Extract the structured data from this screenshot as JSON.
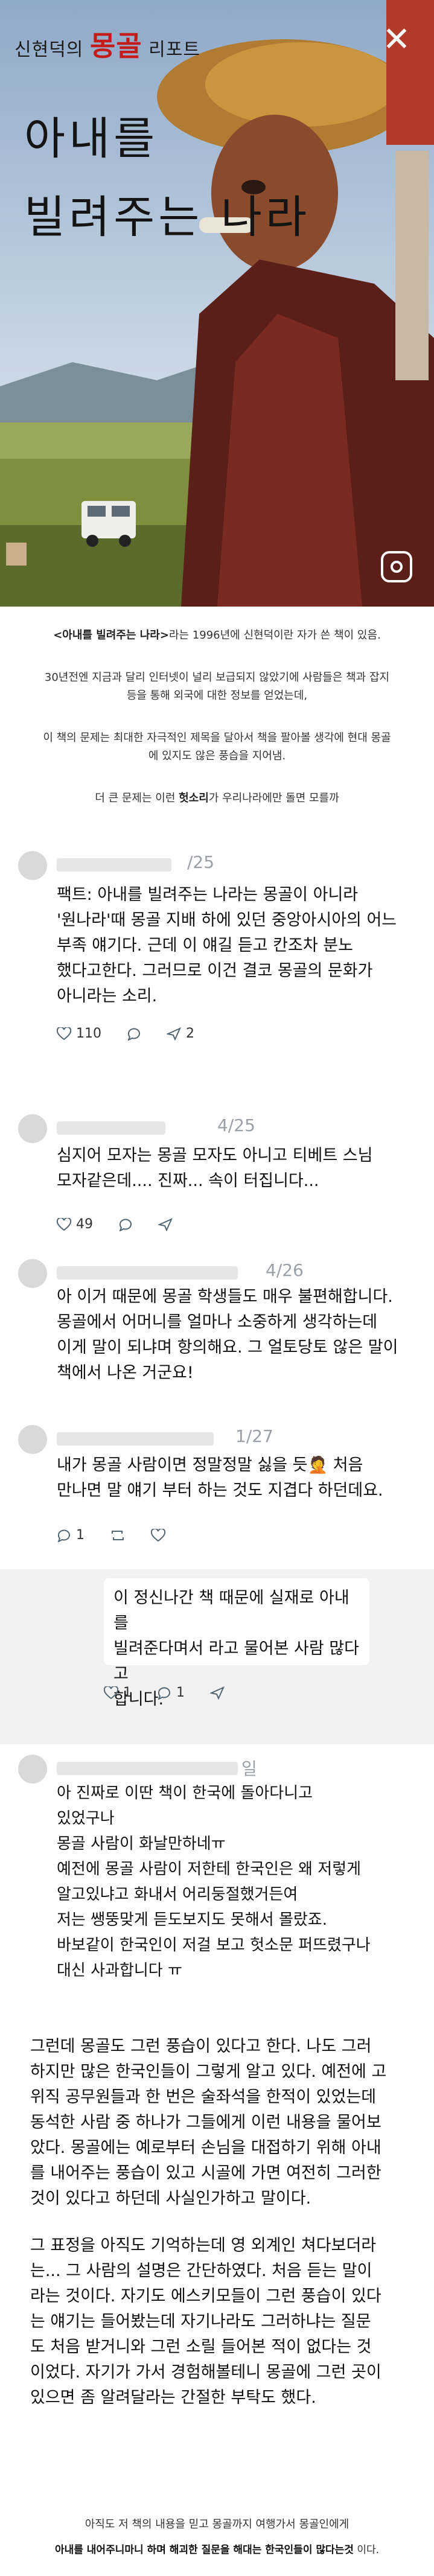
{
  "book": {
    "series_prefix": "신현덕의",
    "series_main": "몽골",
    "series_suffix": "리포트",
    "title_line1": "아내를",
    "title_line2": "빌려주는 나라",
    "close_label": "✕"
  },
  "caption": {
    "line1_title": "<아내를 빌려주는 나라>",
    "line1_rest": "라는 1996년에 신현덕이란 자가 쓴 책이 있음.",
    "line2": "30년전엔 지금과 달리 인터넷이 널리 보급되지 않았기에 사람들은 책과 잡지",
    "line3": "등을 통해 외국에 대한 정보를 얻었는데,",
    "line4": "이 책의 문제는 최대한 자극적인 제목을 달아서 책을 팔아볼 생각에 현대 몽골",
    "line5": "에 있지도 않은 풍습을 지어냄.",
    "line6_pre": "더 큰 문제는 이런 ",
    "line6_bold": "헛소리",
    "line6_post": "가 우리나라에만 돌면 모를까"
  },
  "tweets": [
    {
      "date": "/25",
      "lines": [
        "팩트: 아내를 빌려주는 나라는 몽골이 아니라",
        "'원나라'때 몽골 지배 하에 있던 중앙아시아의 어느",
        "부족 얘기다. 근데 이 얘길 듣고 칸조차 분노",
        "했다고한다. 그러므로 이건 결코 몽골의 문화가",
        "아니라는 소리."
      ],
      "likes": "110",
      "reposts": "2"
    },
    {
      "date": "4/25",
      "lines": [
        "심지어 모자는 몽골 모자도 아니고 티베트 스님",
        "모자같은데.... 진짜... 속이 터집니다..."
      ],
      "likes": "49"
    },
    {
      "date": "4/26",
      "lines": [
        "아 이거 때문에 몽골 학생들도 매우 불편해합니다.",
        "몽골에서 어머니를 얼마나 소중하게 생각하는데",
        "이게 말이 되냐며 항의해요. 그 얼토당토 않은 말이",
        "책에서 나온 거군요!"
      ]
    },
    {
      "date": "1/27",
      "lines": [
        "내가 몽골 사람이면 정말정말 싫을 듯🤦 처음",
        "만나면 말 얘기 부터 하는 것도 지겹다 하던데요."
      ],
      "likes": "1"
    }
  ],
  "dm": {
    "lines": [
      "이 정신나간 책 때문에 실재로 아내를",
      "빌려준다며서 라고 물어본 사람 많다고",
      "합니다."
    ],
    "likes": "1",
    "reposts": "1"
  },
  "message_block": {
    "date": "일",
    "lines": [
      "아 진짜로 이딴 책이 한국에 돌아다니고",
      "있었구나",
      "몽골 사람이 화날만하네ㅠ",
      "예전에 몽골 사람이 저한테 한국인은 왜 저렇게",
      "알고있냐고 화내서 어리둥절했거든여",
      "저는 쌩뚱맞게 듣도보지도 못해서 몰랐죠.",
      "바보같이 한국인이 저걸 보고 헛소문 퍼뜨렸구나",
      "대신 사과합니다 ㅠ"
    ]
  },
  "article": {
    "para1": [
      "그런데 몽골도 그런 풍습이 있다고 한다. 나도 그러",
      "하지만 많은 한국인들이 그렇게 알고 있다. 예전에 고",
      "위직 공무원들과 한 번은 술좌석을 한적이 있었는데",
      "동석한 사람 중 하나가 그들에게 이런 내용을 물어보",
      "았다. 몽골에는 예로부터 손님을 대접하기 위해 아내",
      "를 내어주는 풍습이 있고 시골에 가면 여전히 그러한",
      "것이 있다고 하던데 사실인가하고 말이다."
    ],
    "para2": [
      "그 표정을 아직도 기억하는데 영 외계인 쳐다보더라",
      "는... 그 사람의 설명은 간단하였다. 처음 듣는 말이",
      "라는 것이다. 자기도 에스키모들이 그런 풍습이 있다",
      "는 얘기는 들어봤는데 자기나라도 그러하냐는 질문",
      "도 처음 받거니와 그런 소릴 들어본 적이 없다는 것",
      "이었다. 자기가 가서 경험해볼테니 몽골에 그런 곳이",
      "있으면 좀 알려달라는 간절한 부탁도 했다."
    ]
  },
  "footer": {
    "line1": "아직도 저 책의 내용을 믿고 몽골까지 여행가서 몽골인에게",
    "line2_bold": "아내를 내어주니마니 하며 해괴한 질문을 해대는 한국인들이 많다는것",
    "line2_rest": " 이다."
  },
  "colors": {
    "series_accent": "#c61b1b",
    "caption_title": "#7a2a2a",
    "icon_gray": "#536471"
  }
}
